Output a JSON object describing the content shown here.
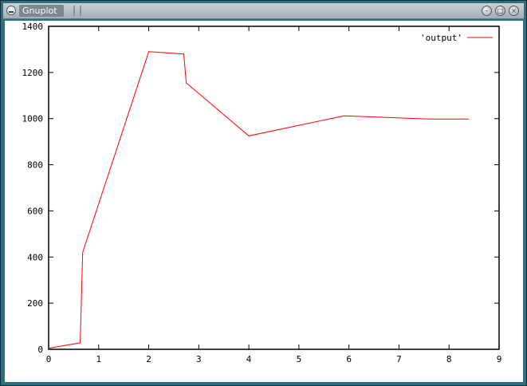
{
  "window": {
    "title": "Gnuplot",
    "menu_icon": "window-menu-icon",
    "buttons": [
      {
        "name": "minimize-button",
        "glyph": "–"
      },
      {
        "name": "maximize-button",
        "glyph": "□"
      },
      {
        "name": "close-button",
        "glyph": "×"
      }
    ]
  },
  "chart_data": {
    "type": "line",
    "title": "",
    "xlabel": "",
    "ylabel": "",
    "xlim": [
      0,
      9
    ],
    "ylim": [
      0,
      1400
    ],
    "x_ticks": [
      0,
      1,
      2,
      3,
      4,
      5,
      6,
      7,
      8,
      9
    ],
    "y_ticks": [
      0,
      200,
      400,
      600,
      800,
      1000,
      1200,
      1400
    ],
    "grid": false,
    "legend_position": "top-right",
    "series": [
      {
        "name": "'output'",
        "color": "#ff0000",
        "x": [
          0,
          0.63,
          0.68,
          2.0,
          2.7,
          2.75,
          4.0,
          5.9,
          7.6,
          8.4
        ],
        "y": [
          5,
          28,
          420,
          1290,
          1280,
          1155,
          925,
          1012,
          998,
          998
        ]
      }
    ]
  }
}
